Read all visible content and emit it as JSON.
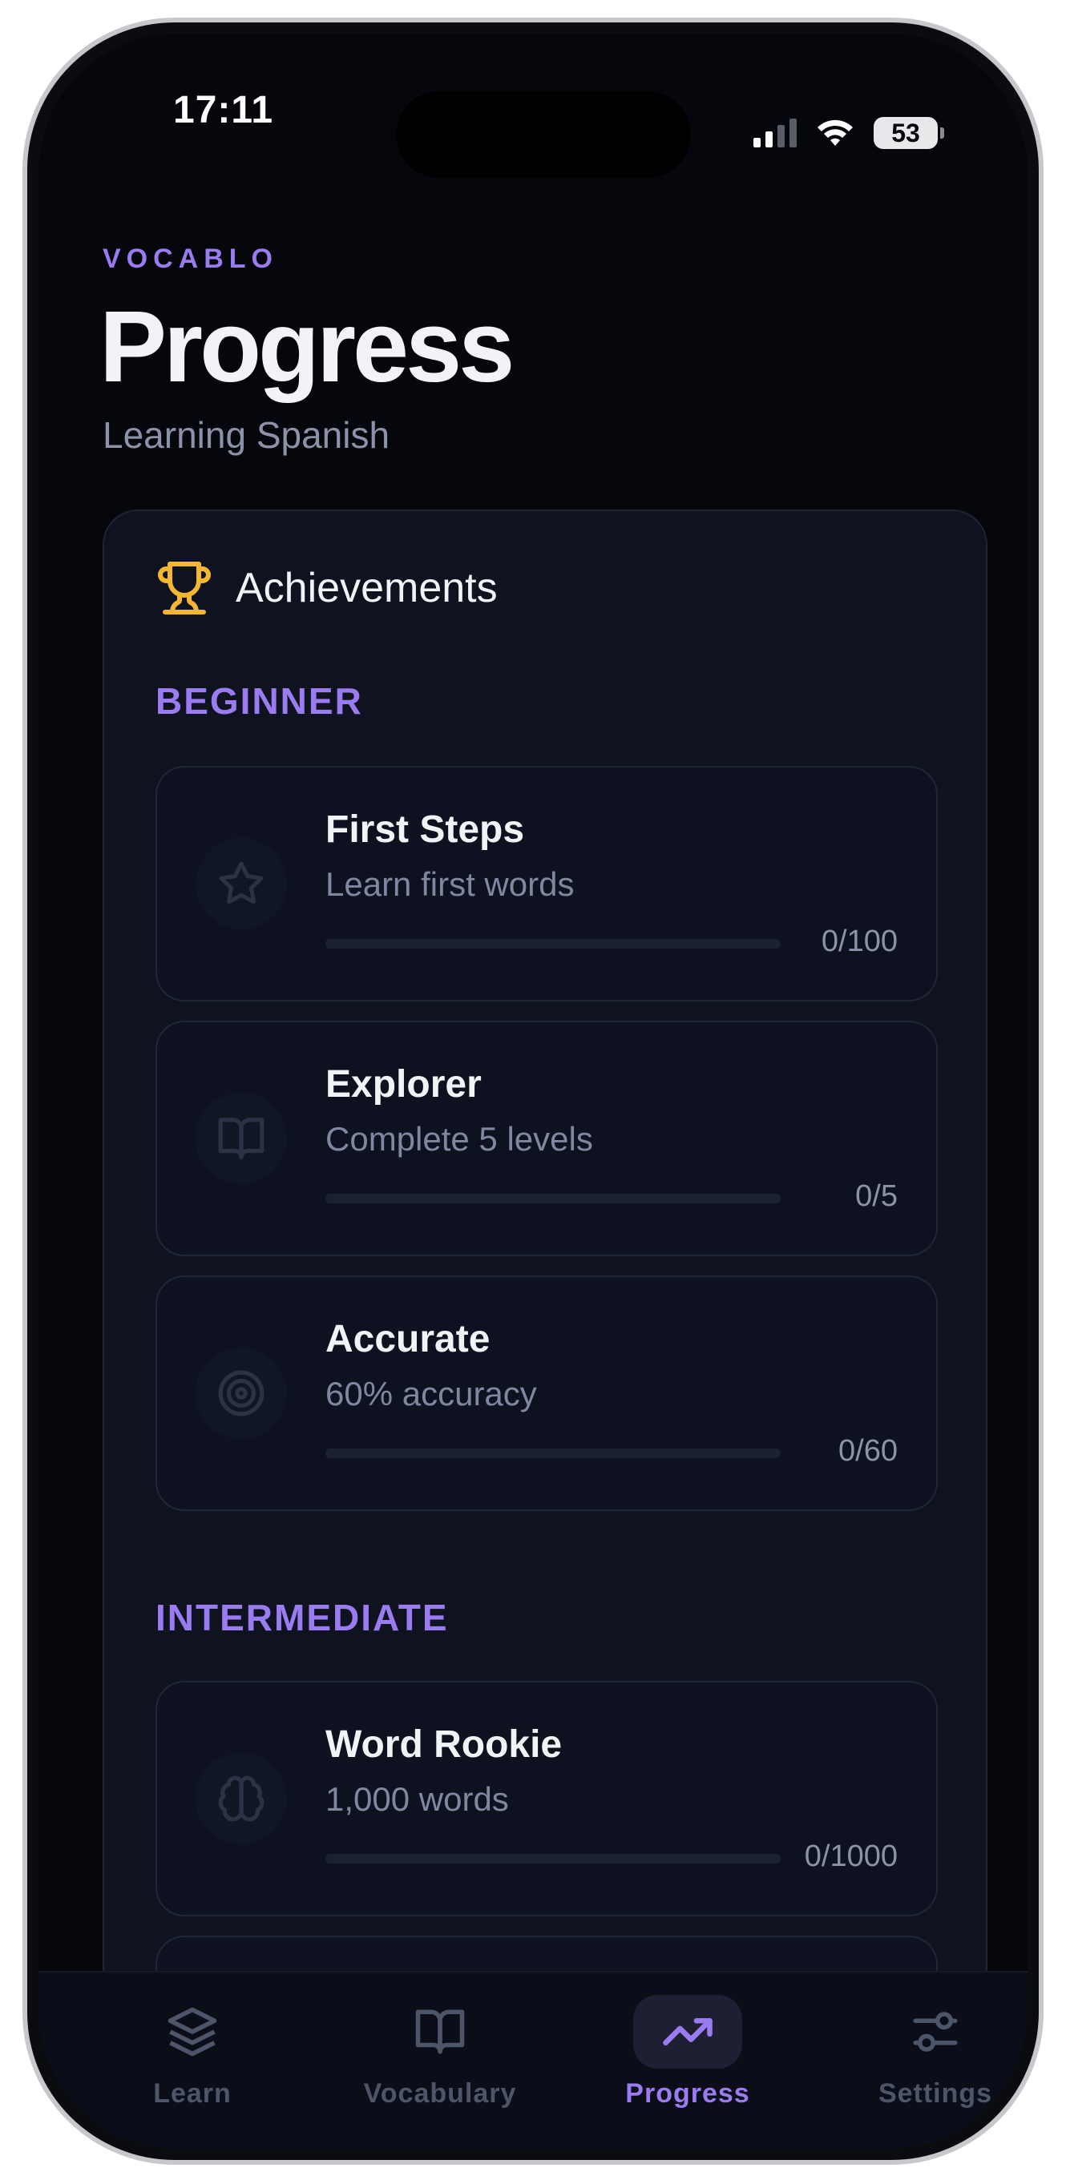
{
  "status_bar": {
    "time": "17:11",
    "battery": "53"
  },
  "header": {
    "brand": "VOCABLO",
    "title": "Progress",
    "subtitle": "Learning Spanish"
  },
  "achievements": {
    "title": "Achievements",
    "sections": [
      {
        "label": "BEGINNER",
        "items": [
          {
            "name": "First Steps",
            "description": "Learn first words",
            "count": "0/100",
            "progress": 0,
            "icon": "star-icon"
          },
          {
            "name": "Explorer",
            "description": "Complete 5 levels",
            "count": "0/5",
            "progress": 0,
            "icon": "book-icon"
          },
          {
            "name": "Accurate",
            "description": "60% accuracy",
            "count": "0/60",
            "progress": 0,
            "icon": "target-icon"
          }
        ]
      },
      {
        "label": "INTERMEDIATE",
        "items": [
          {
            "name": "Word Rookie",
            "description": "1,000 words",
            "count": "0/1000",
            "progress": 0,
            "icon": "brain-icon"
          }
        ]
      }
    ]
  },
  "tabs": [
    {
      "label": "Learn",
      "icon": "layers-icon",
      "active": false
    },
    {
      "label": "Vocabulary",
      "icon": "book-open-icon",
      "active": false
    },
    {
      "label": "Progress",
      "icon": "trending-up-icon",
      "active": true
    },
    {
      "label": "Settings",
      "icon": "sliders-icon",
      "active": false
    }
  ],
  "colors": {
    "accent": "#9b7bf0",
    "background": "#05070c",
    "card": "#0f1320",
    "trophy": "#f5b731"
  }
}
